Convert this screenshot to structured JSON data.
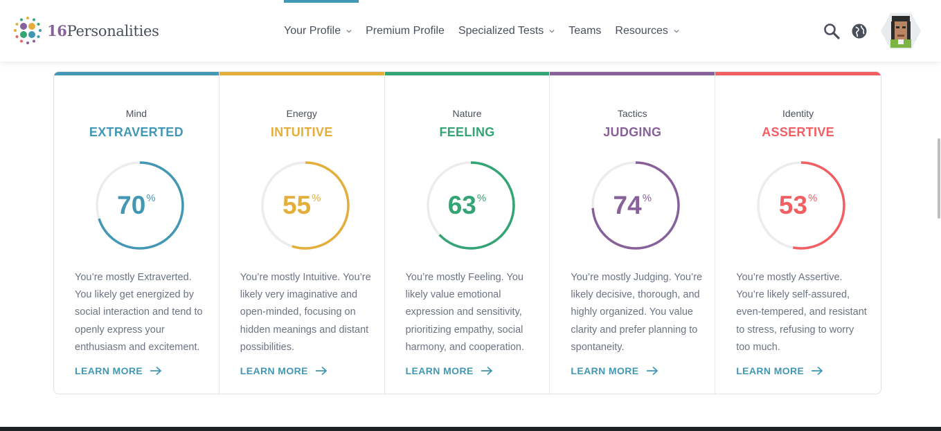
{
  "brand": {
    "logo_number": "16",
    "logo_word": "Personalities"
  },
  "nav": {
    "items": [
      {
        "label": "Your Profile",
        "has_dropdown": true,
        "active": true
      },
      {
        "label": "Premium Profile",
        "has_dropdown": false
      },
      {
        "label": "Specialized Tests",
        "has_dropdown": true
      },
      {
        "label": "Teams",
        "has_dropdown": false
      },
      {
        "label": "Resources",
        "has_dropdown": true
      }
    ]
  },
  "header_icons": [
    "search-icon",
    "globe-icon",
    "user-avatar"
  ],
  "colors": {
    "mind": "#4298b4",
    "energy": "#e4ae3a",
    "nature": "#33a474",
    "tactics": "#88619a",
    "identity": "#f25e62"
  },
  "traits": [
    {
      "category": "Mind",
      "name": "EXTRAVERTED",
      "percent": "70",
      "percent_sign": "%",
      "color": "#4298b4",
      "description": "You’re mostly Extraverted. You likely get energized by social interaction and tend to openly express your enthusiasm and excitement.",
      "link": "LEARN MORE"
    },
    {
      "category": "Energy",
      "name": "INTUITIVE",
      "percent": "55",
      "percent_sign": "%",
      "color": "#e4ae3a",
      "description": "You’re mostly Intuitive. You’re likely very imaginative and open-minded, focusing on hidden meanings and distant possibilities.",
      "link": "LEARN MORE"
    },
    {
      "category": "Nature",
      "name": "FEELING",
      "percent": "63",
      "percent_sign": "%",
      "color": "#33a474",
      "description": "You’re mostly Feeling. You likely value emotional expression and sensitivity, prioritizing empathy, social harmony, and cooperation.",
      "link": "LEARN MORE"
    },
    {
      "category": "Tactics",
      "name": "JUDGING",
      "percent": "74",
      "percent_sign": "%",
      "color": "#88619a",
      "description": "You’re mostly Judging. You’re likely decisive, thorough, and highly organized. You value clarity and prefer planning to spontaneity.",
      "link": "LEARN MORE"
    },
    {
      "category": "Identity",
      "name": "ASSERTIVE",
      "percent": "53",
      "percent_sign": "%",
      "color": "#f25e62",
      "description": "You’re mostly Assertive. You’re likely self-assured, even-tempered, and resistant to stress, refusing to worry too much.",
      "link": "LEARN MORE"
    }
  ]
}
